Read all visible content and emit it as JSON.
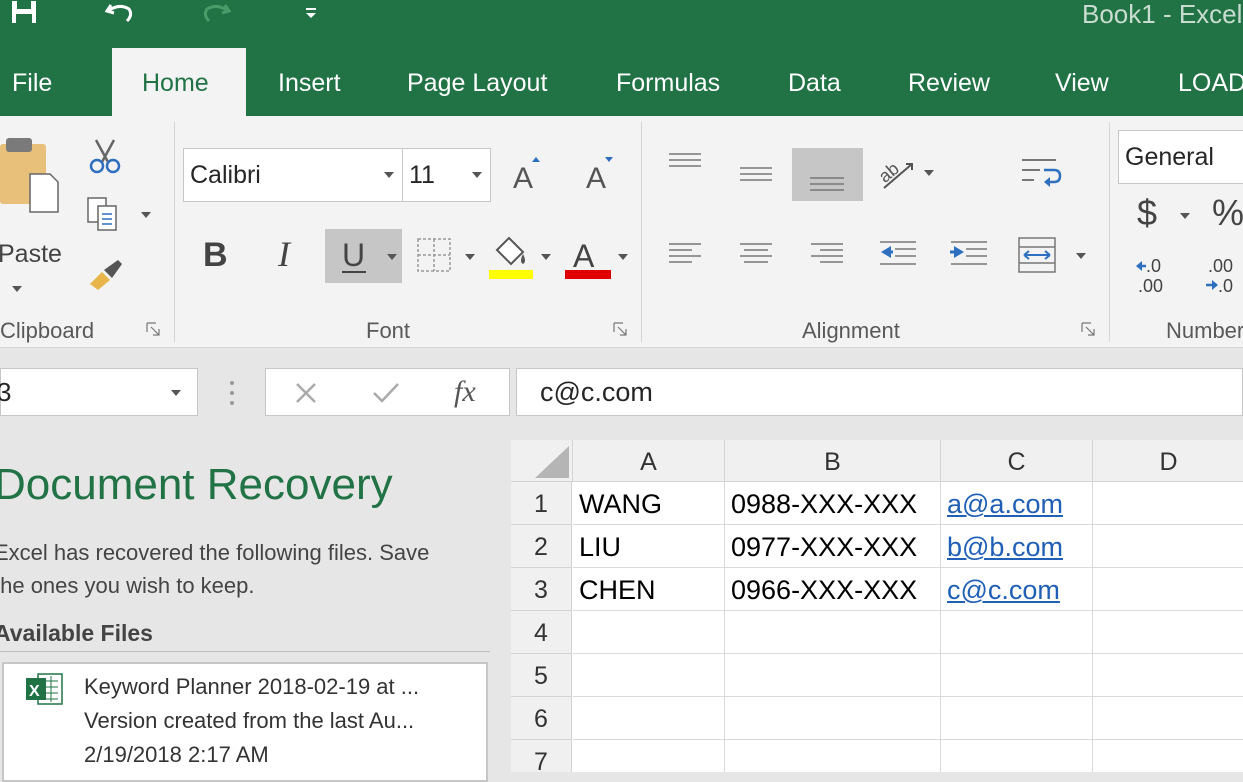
{
  "title_bar": {
    "title": "Book1  -  Excel"
  },
  "tabs": [
    "File",
    "Home",
    "Insert",
    "Page Layout",
    "Formulas",
    "Data",
    "Review",
    "View",
    "LOAD"
  ],
  "ribbon": {
    "clipboard": {
      "paste_label": "Paste",
      "group_label": "Clipboard"
    },
    "font": {
      "font_name": "Calibri",
      "font_size": "11",
      "group_label": "Font",
      "highlight_color": "#ffff00",
      "font_color": "#ff0000"
    },
    "alignment": {
      "group_label": "Alignment"
    },
    "number": {
      "format": "General",
      "currency_symbol": "$",
      "percent_symbol": "%",
      "increase_decimal": ".0\n.00",
      "decrease_decimal": ".00\n.0",
      "group_label": "Number"
    }
  },
  "formula_bar": {
    "name_box": "3",
    "formula": "c@c.com"
  },
  "recovery": {
    "title": "Document Recovery",
    "message_line1": "Excel has recovered the following files.  Save",
    "message_line2": "the ones you wish to keep.",
    "available_files_label": "Available Files",
    "files": [
      {
        "name": "Keyword Planner 2018-02-19 at ...",
        "detail": "Version created from the last Au...",
        "date": "2/19/2018 2:17 AM"
      }
    ]
  },
  "sheet": {
    "columns": [
      "A",
      "B",
      "C",
      "D"
    ],
    "rows": [
      "1",
      "2",
      "3",
      "4",
      "5",
      "6",
      "7"
    ],
    "cells": [
      [
        "WANG",
        "0988-XXX-XXX",
        "a@a.com",
        ""
      ],
      [
        "LIU",
        "0977-XXX-XXX",
        "b@b.com",
        ""
      ],
      [
        "CHEN",
        "0966-XXX-XXX",
        "c@c.com",
        ""
      ],
      [
        "",
        "",
        "",
        ""
      ],
      [
        "",
        "",
        "",
        ""
      ],
      [
        "",
        "",
        "",
        ""
      ],
      [
        "",
        "",
        "",
        ""
      ]
    ]
  },
  "colors": {
    "brand": "#217346",
    "link": "#1f5fb5"
  }
}
